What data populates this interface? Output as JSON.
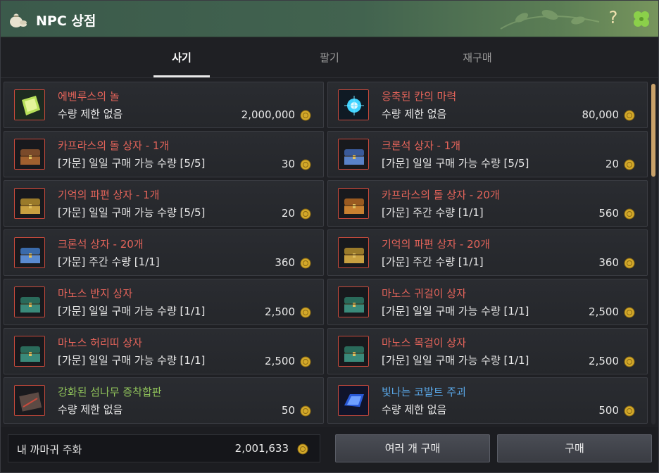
{
  "window": {
    "title": "NPC 상점",
    "help_label": "?"
  },
  "tabs": [
    {
      "label": "사기",
      "active": true
    },
    {
      "label": "팔기",
      "active": false
    },
    {
      "label": "재구매",
      "active": false
    }
  ],
  "items": [
    {
      "name": "에벤루스의 놀",
      "limit": "수량 제한 없음",
      "price": "2,000,000",
      "name_color": "red",
      "icon": "gem-icon"
    },
    {
      "name": "응축된 칸의 마력",
      "limit": "수량 제한 없음",
      "price": "80,000",
      "name_color": "red",
      "icon": "orb-icon"
    },
    {
      "name": "카프라스의 돌 상자 - 1개",
      "limit": "[가문] 일일 구매 가능 수량 [5/5]",
      "price": "30",
      "name_color": "red",
      "icon": "chest-icon"
    },
    {
      "name": "크론석 상자 - 1개",
      "limit": "[가문] 일일 구매 가능 수량 [5/5]",
      "price": "20",
      "name_color": "red",
      "icon": "chest-icon"
    },
    {
      "name": "기억의 파편 상자 - 1개",
      "limit": "[가문] 일일 구매 가능 수량 [5/5]",
      "price": "20",
      "name_color": "red",
      "icon": "chest-icon"
    },
    {
      "name": "카프라스의 돌 상자 - 20개",
      "limit": "[가문] 주간 수량 [1/1]",
      "price": "560",
      "name_color": "red",
      "icon": "chest-icon"
    },
    {
      "name": "크론석 상자 - 20개",
      "limit": "[가문] 주간 수량 [1/1]",
      "price": "360",
      "name_color": "red",
      "icon": "chest-icon"
    },
    {
      "name": "기억의 파편 상자 - 20개",
      "limit": "[가문] 주간 수량 [1/1]",
      "price": "360",
      "name_color": "red",
      "icon": "chest-icon"
    },
    {
      "name": "마노스 반지 상자",
      "limit": "[가문] 일일 구매 가능 수량 [1/1]",
      "price": "2,500",
      "name_color": "red",
      "icon": "chest-icon"
    },
    {
      "name": "마노스 귀걸이 상자",
      "limit": "[가문] 일일 구매 가능 수량 [1/1]",
      "price": "2,500",
      "name_color": "red",
      "icon": "chest-icon"
    },
    {
      "name": "마노스 허리띠 상자",
      "limit": "[가문] 일일 구매 가능 수량 [1/1]",
      "price": "2,500",
      "name_color": "red",
      "icon": "chest-icon"
    },
    {
      "name": "마노스 목걸이 상자",
      "limit": "[가문] 일일 구매 가능 수량 [1/1]",
      "price": "2,500",
      "name_color": "red",
      "icon": "chest-icon"
    },
    {
      "name": "강화된 섬나무 증착합판",
      "limit": "수량 제한 없음",
      "price": "50",
      "name_color": "green",
      "icon": "plank-icon"
    },
    {
      "name": "빛나는 코발트 주괴",
      "limit": "수량 제한 없음",
      "price": "500",
      "name_color": "blue",
      "icon": "ingot-icon"
    }
  ],
  "bottom": {
    "currency_label": "내 까마귀 주화",
    "currency_amount": "2,001,633",
    "bulk_buy_label": "여러 개 구매",
    "buy_label": "구매"
  },
  "colors": {
    "name_red": "#e5645a",
    "name_green": "#8fc15a",
    "name_blue": "#5aa8e8",
    "coin_gold": "#d4a92a",
    "title_bar": "#42634f"
  }
}
